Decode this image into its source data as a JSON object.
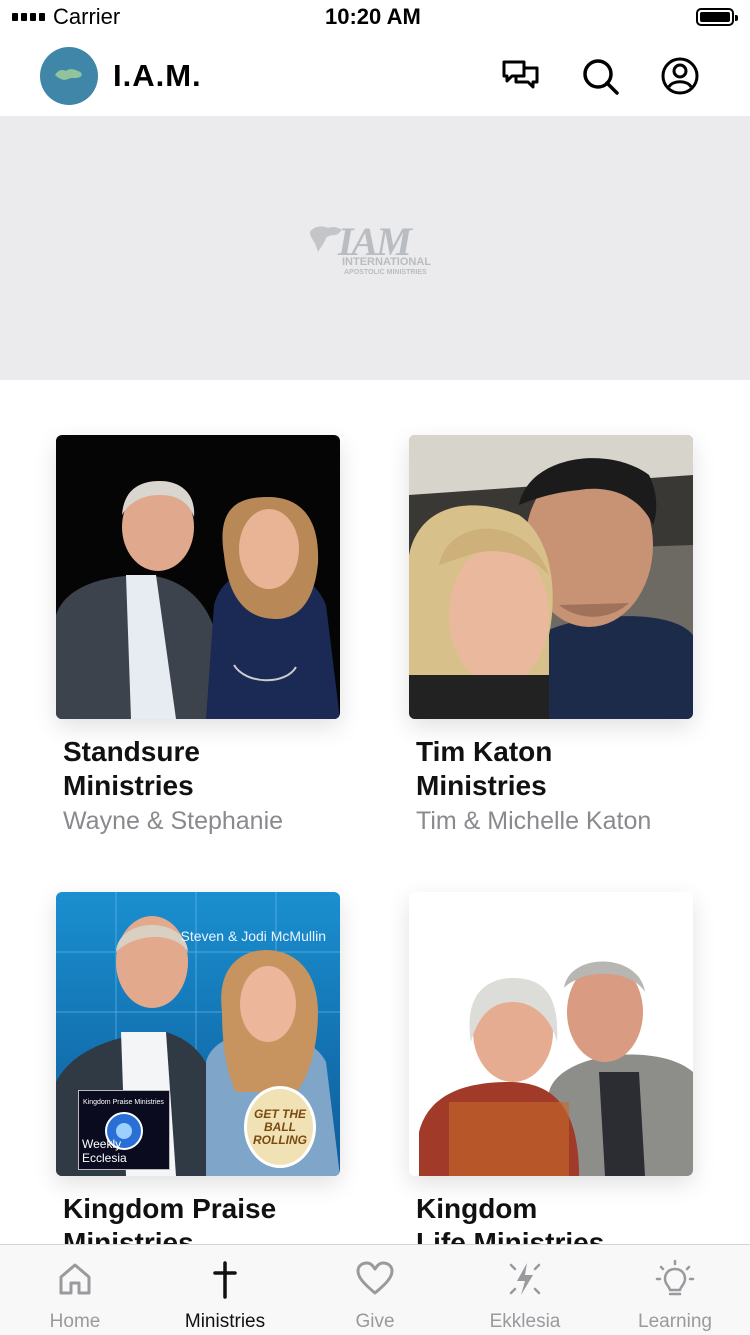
{
  "status_bar": {
    "carrier": "Carrier",
    "time": "10:20 AM"
  },
  "header": {
    "title": "I.A.M."
  },
  "banner": {
    "logo_wordmark": "IAM",
    "logo_line1": "INTERNATIONAL",
    "logo_line2": "APOSTOLIC MINISTRIES"
  },
  "ministries": [
    {
      "title_line1": "Standsure",
      "title_line2": "Ministries",
      "subtitle": "Wayne & Stephanie"
    },
    {
      "title_line1": "Tim Katon",
      "title_line2": "Ministries",
      "subtitle": "Tim & Michelle Katon"
    },
    {
      "title_line1": "Kingdom Praise",
      "title_line2": "Ministries",
      "subtitle": "",
      "image_caption": "Steven & Jodi McMullin",
      "badge_title": "Kingdom Praise Ministries",
      "badge_caption": "Weekly Ecclesia",
      "ball_text": "GET THE BALL ROLLING"
    },
    {
      "title_line1": "Kingdom",
      "title_line2": "Life Ministries",
      "subtitle": ""
    }
  ],
  "tabs": [
    {
      "label": "Home",
      "icon": "home-icon",
      "active": false
    },
    {
      "label": "Ministries",
      "icon": "cross-icon",
      "active": true
    },
    {
      "label": "Give",
      "icon": "heart-icon",
      "active": false
    },
    {
      "label": "Ekklesia",
      "icon": "spark-icon",
      "active": false
    },
    {
      "label": "Learning",
      "icon": "lightbulb-icon",
      "active": false
    }
  ],
  "colors": {
    "logo_bg": "#3f86a8",
    "banner_bg": "#ebebed",
    "tab_active": "#111111",
    "tab_inactive": "#9a9a9e"
  }
}
